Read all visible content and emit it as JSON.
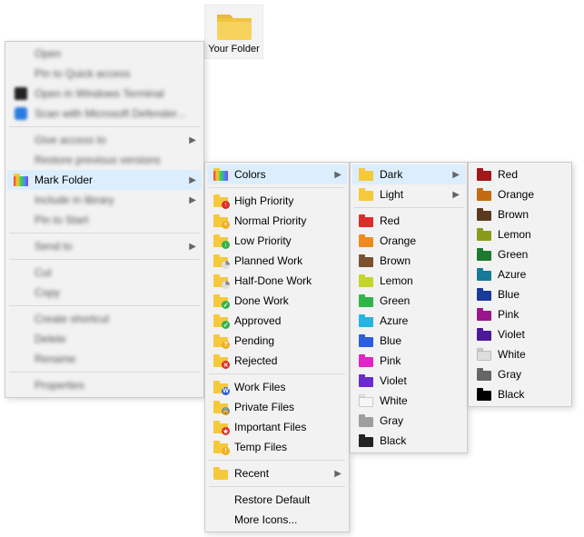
{
  "folder_tile": {
    "label": "Your Folder"
  },
  "menu1": {
    "groups": [
      [
        {
          "label": "Open",
          "blurred": true
        },
        {
          "label": "Pin to Quick access",
          "blurred": true
        },
        {
          "label": "Open in Windows Terminal",
          "blurred": true,
          "icon": "terminal"
        },
        {
          "label": "Scan with Microsoft Defender...",
          "blurred": true,
          "icon": "shield"
        }
      ],
      [
        {
          "label": "Give access to",
          "blurred": true,
          "submenu": true
        },
        {
          "label": "Restore previous versions",
          "blurred": true
        },
        {
          "label": "Mark Folder",
          "blurred": false,
          "submenu": true,
          "icon": "rainbow-folder",
          "highlight": true
        },
        {
          "label": "Include in library",
          "blurred": true,
          "submenu": true
        },
        {
          "label": "Pin to Start",
          "blurred": true
        }
      ],
      [
        {
          "label": "Send to",
          "blurred": true,
          "submenu": true
        }
      ],
      [
        {
          "label": "Cut",
          "blurred": true
        },
        {
          "label": "Copy",
          "blurred": true
        }
      ],
      [
        {
          "label": "Create shortcut",
          "blurred": true
        },
        {
          "label": "Delete",
          "blurred": true
        },
        {
          "label": "Rename",
          "blurred": true
        }
      ],
      [
        {
          "label": "Properties",
          "blurred": true
        }
      ]
    ]
  },
  "menu2": {
    "groups": [
      [
        {
          "label": "Colors",
          "submenu": true,
          "icon": "rainbow-folder",
          "highlight": true
        }
      ],
      [
        {
          "label": "High Priority",
          "icon": "folder",
          "color": "c-yellow",
          "badge": "↑",
          "badge_bg": "#e02b2b"
        },
        {
          "label": "Normal Priority",
          "icon": "folder",
          "color": "c-yellow",
          "badge": "•",
          "badge_bg": "#efb21f"
        },
        {
          "label": "Low Priority",
          "icon": "folder",
          "color": "c-yellow",
          "badge": "↓",
          "badge_bg": "#2fb54a"
        },
        {
          "label": "Planned Work",
          "icon": "folder",
          "color": "c-yellow",
          "badge_type": "clock"
        },
        {
          "label": "Half-Done Work",
          "icon": "folder",
          "color": "c-yellow",
          "badge_type": "clock"
        },
        {
          "label": "Done Work",
          "icon": "folder",
          "color": "c-yellow",
          "badge": "✓",
          "badge_bg": "#2fb54a"
        },
        {
          "label": "Approved",
          "icon": "folder",
          "color": "c-yellow",
          "badge": "✓",
          "badge_bg": "#2fb54a"
        },
        {
          "label": "Pending",
          "icon": "folder",
          "color": "c-yellow",
          "badge": "?",
          "badge_bg": "#efb21f"
        },
        {
          "label": "Rejected",
          "icon": "folder",
          "color": "c-yellow",
          "badge": "✕",
          "badge_bg": "#e02b2b"
        }
      ],
      [
        {
          "label": "Work Files",
          "icon": "folder",
          "color": "c-yellow",
          "badge": "W",
          "badge_bg": "#2a5de0"
        },
        {
          "label": "Private Files",
          "icon": "folder",
          "color": "c-yellow",
          "badge": "🔒",
          "badge_bg": "#888"
        },
        {
          "label": "Important Files",
          "icon": "folder",
          "color": "c-yellow",
          "badge": "★",
          "badge_bg": "#e02b2b"
        },
        {
          "label": "Temp Files",
          "icon": "folder",
          "color": "c-yellow",
          "badge": "!",
          "badge_bg": "#efb21f"
        }
      ],
      [
        {
          "label": "Recent",
          "submenu": true,
          "icon": "folder",
          "color": "c-yellow"
        }
      ],
      [
        {
          "label": "Restore Default"
        },
        {
          "label": "More Icons..."
        }
      ]
    ]
  },
  "menu3": {
    "groups": [
      [
        {
          "label": "Dark",
          "submenu": true,
          "icon": "folder",
          "color": "c-yellow",
          "highlight": true
        },
        {
          "label": "Light",
          "submenu": true,
          "icon": "folder",
          "color": "c-yellow"
        }
      ],
      [
        {
          "label": "Red",
          "icon": "folder",
          "color": "c-red"
        },
        {
          "label": "Orange",
          "icon": "folder",
          "color": "c-orange"
        },
        {
          "label": "Brown",
          "icon": "folder",
          "color": "c-brown"
        },
        {
          "label": "Lemon",
          "icon": "folder",
          "color": "c-lemon"
        },
        {
          "label": "Green",
          "icon": "folder",
          "color": "c-green"
        },
        {
          "label": "Azure",
          "icon": "folder",
          "color": "c-azure"
        },
        {
          "label": "Blue",
          "icon": "folder",
          "color": "c-blue"
        },
        {
          "label": "Pink",
          "icon": "folder",
          "color": "c-pink"
        },
        {
          "label": "Violet",
          "icon": "folder",
          "color": "c-violet"
        },
        {
          "label": "White",
          "icon": "folder",
          "color": "c-white"
        },
        {
          "label": "Gray",
          "icon": "folder",
          "color": "c-gray"
        },
        {
          "label": "Black",
          "icon": "folder",
          "color": "c-black"
        }
      ]
    ]
  },
  "menu4": {
    "groups": [
      [
        {
          "label": "Red",
          "icon": "folder",
          "color": "c-dred"
        },
        {
          "label": "Orange",
          "icon": "folder",
          "color": "c-dorange"
        },
        {
          "label": "Brown",
          "icon": "folder",
          "color": "c-dbrown"
        },
        {
          "label": "Lemon",
          "icon": "folder",
          "color": "c-dlemon"
        },
        {
          "label": "Green",
          "icon": "folder",
          "color": "c-dgreen"
        },
        {
          "label": "Azure",
          "icon": "folder",
          "color": "c-dazure"
        },
        {
          "label": "Blue",
          "icon": "folder",
          "color": "c-dblue"
        },
        {
          "label": "Pink",
          "icon": "folder",
          "color": "c-dpink"
        },
        {
          "label": "Violet",
          "icon": "folder",
          "color": "c-dviolet"
        },
        {
          "label": "White",
          "icon": "folder",
          "color": "c-dwhite"
        },
        {
          "label": "Gray",
          "icon": "folder",
          "color": "c-dgray"
        },
        {
          "label": "Black",
          "icon": "folder",
          "color": "c-dblack"
        }
      ]
    ]
  }
}
